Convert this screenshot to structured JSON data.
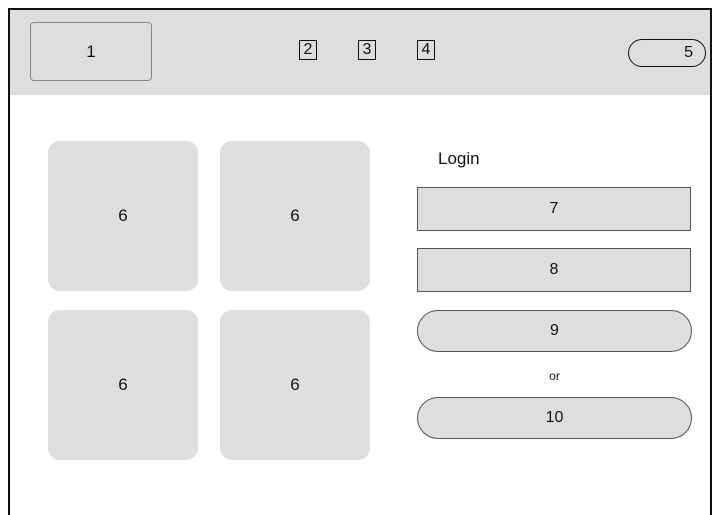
{
  "topbar": {
    "logo_label": "1",
    "nav_items": [
      "2",
      "3",
      "4"
    ],
    "profile_pill_label": "5"
  },
  "tiles": [
    "6",
    "6",
    "6",
    "6"
  ],
  "login": {
    "title": "Login",
    "field_1": "7",
    "field_2": "8",
    "button_1": "9",
    "separator": "or",
    "button_2": "10"
  }
}
